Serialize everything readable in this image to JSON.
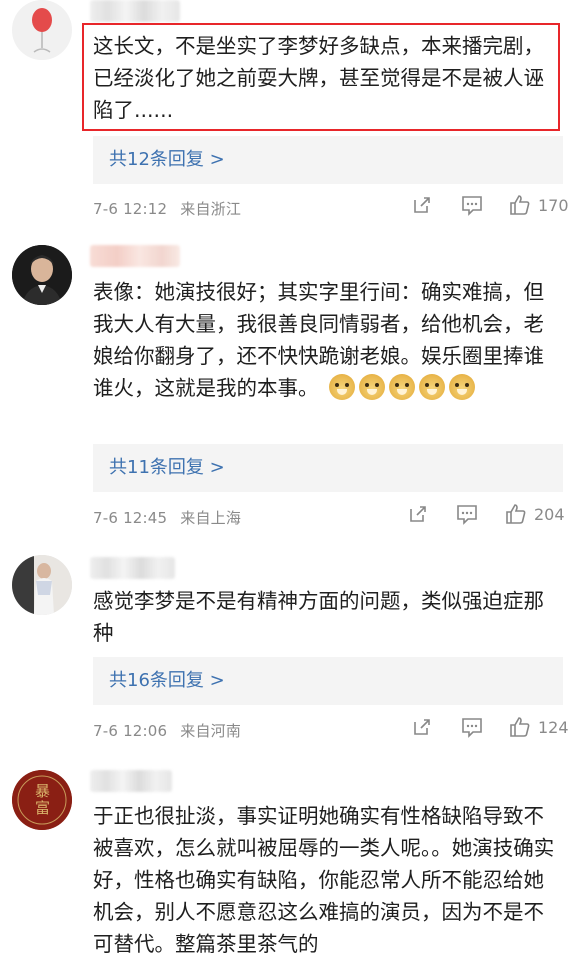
{
  "comments": [
    {
      "text": "这长文，不是坐实了李梦好多缺点，本来播完剧，已经淡化了她之前耍大牌，甚至觉得是不是被人诬陷了......",
      "replies": "共12条回复 >",
      "time": "7-6 12:12",
      "location": "来自浙江",
      "likes": "170"
    },
    {
      "text": "表像：她演技很好；其实字里行间：确实难搞，但我大人有大量，我很善良同情弱者，给他机会，老娘给你翻身了，还不快快跪谢老娘。娱乐圈里捧谁谁火，这就是我的本事。",
      "emoji_count": 5,
      "replies": "共11条回复 >",
      "time": "7-6 12:45",
      "location": "来自上海",
      "likes": "204"
    },
    {
      "text": "感觉李梦是不是有精神方面的问题，类似强迫症那种",
      "replies": "共16条回复 >",
      "time": "7-6 12:06",
      "location": "来自河南",
      "likes": "124"
    },
    {
      "text": "于正也很扯淡，事实证明她确实有性格缺陷导致不被喜欢，怎么就叫被屈辱的一类人呢。。她演技确实好，性格也确实有缺陷，你能忍常人所不能忍给她机会，别人不愿意忍这么难搞的演员，因为不是不可替代。整篇茶里茶气的",
      "avatar_text": "暴富"
    }
  ],
  "icons": {
    "share": "share-icon",
    "comment": "comment-icon",
    "like": "thumbs-up-icon",
    "emoji": "doge-emoji-icon"
  },
  "colors": {
    "highlight": "#e8262a",
    "link": "#3e72b0",
    "meta": "#8a8a8a",
    "reply_bg": "#f4f4f4"
  }
}
